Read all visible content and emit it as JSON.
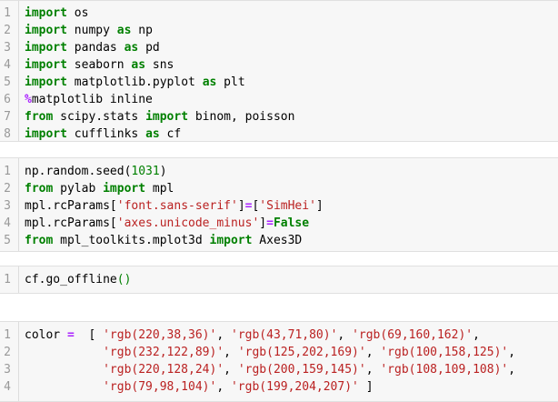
{
  "cells": [
    {
      "lines": [
        {
          "n": "1",
          "tokens": [
            {
              "t": "kw",
              "v": "import"
            },
            {
              "t": "",
              "v": " os"
            }
          ]
        },
        {
          "n": "2",
          "tokens": [
            {
              "t": "kw",
              "v": "import"
            },
            {
              "t": "",
              "v": " numpy "
            },
            {
              "t": "kw",
              "v": "as"
            },
            {
              "t": "",
              "v": " np"
            }
          ]
        },
        {
          "n": "3",
          "tokens": [
            {
              "t": "kw",
              "v": "import"
            },
            {
              "t": "",
              "v": " pandas "
            },
            {
              "t": "kw",
              "v": "as"
            },
            {
              "t": "",
              "v": " pd"
            }
          ]
        },
        {
          "n": "4",
          "tokens": [
            {
              "t": "kw",
              "v": "import"
            },
            {
              "t": "",
              "v": " seaborn "
            },
            {
              "t": "kw",
              "v": "as"
            },
            {
              "t": "",
              "v": " sns"
            }
          ]
        },
        {
          "n": "5",
          "tokens": [
            {
              "t": "kw",
              "v": "import"
            },
            {
              "t": "",
              "v": " matplotlib.pyplot "
            },
            {
              "t": "kw",
              "v": "as"
            },
            {
              "t": "",
              "v": " plt"
            }
          ]
        },
        {
          "n": "6",
          "tokens": [
            {
              "t": "op",
              "v": "%"
            },
            {
              "t": "",
              "v": "matplotlib inline"
            }
          ]
        },
        {
          "n": "7",
          "tokens": [
            {
              "t": "kw",
              "v": "from"
            },
            {
              "t": "",
              "v": " scipy.stats "
            },
            {
              "t": "kw",
              "v": "import"
            },
            {
              "t": "",
              "v": " binom, poisson"
            }
          ]
        },
        {
          "n": "8",
          "tokens": [
            {
              "t": "kw",
              "v": "import"
            },
            {
              "t": "",
              "v": " cufflinks "
            },
            {
              "t": "kw",
              "v": "as"
            },
            {
              "t": "",
              "v": " cf"
            }
          ]
        }
      ]
    },
    {
      "lines": [
        {
          "n": "1",
          "tokens": [
            {
              "t": "",
              "v": "np.random.seed("
            },
            {
              "t": "num",
              "v": "1031"
            },
            {
              "t": "",
              "v": ")"
            }
          ]
        },
        {
          "n": "2",
          "tokens": [
            {
              "t": "kw",
              "v": "from"
            },
            {
              "t": "",
              "v": " pylab "
            },
            {
              "t": "kw",
              "v": "import"
            },
            {
              "t": "",
              "v": " mpl"
            }
          ]
        },
        {
          "n": "3",
          "tokens": [
            {
              "t": "",
              "v": "mpl.rcParams["
            },
            {
              "t": "str",
              "v": "'font.sans-serif'"
            },
            {
              "t": "",
              "v": "]"
            },
            {
              "t": "op",
              "v": "="
            },
            {
              "t": "",
              "v": "["
            },
            {
              "t": "str",
              "v": "'SimHei'"
            },
            {
              "t": "",
              "v": "]"
            }
          ]
        },
        {
          "n": "4",
          "tokens": [
            {
              "t": "",
              "v": "mpl.rcParams["
            },
            {
              "t": "str",
              "v": "'axes.unicode_minus'"
            },
            {
              "t": "",
              "v": "]"
            },
            {
              "t": "op",
              "v": "="
            },
            {
              "t": "kw",
              "v": "False"
            }
          ]
        },
        {
          "n": "5",
          "tokens": [
            {
              "t": "kw",
              "v": "from"
            },
            {
              "t": "",
              "v": " mpl_toolkits.mplot3d "
            },
            {
              "t": "kw",
              "v": "import"
            },
            {
              "t": "",
              "v": " Axes3D"
            }
          ]
        }
      ]
    },
    {
      "lines": [
        {
          "n": "1",
          "tokens": [
            {
              "t": "",
              "v": "cf.go_offline"
            },
            {
              "t": "paren-hl",
              "v": "()"
            }
          ]
        }
      ]
    },
    {
      "lines": [
        {
          "n": "1",
          "tokens": [
            {
              "t": "",
              "v": "color "
            },
            {
              "t": "op",
              "v": "="
            },
            {
              "t": "",
              "v": "  [ "
            },
            {
              "t": "str",
              "v": "'rgb(220,38,36)'"
            },
            {
              "t": "",
              "v": ", "
            },
            {
              "t": "str",
              "v": "'rgb(43,71,80)'"
            },
            {
              "t": "",
              "v": ", "
            },
            {
              "t": "str",
              "v": "'rgb(69,160,162)'"
            },
            {
              "t": "",
              "v": ","
            }
          ]
        },
        {
          "n": "2",
          "tokens": [
            {
              "t": "",
              "v": "           "
            },
            {
              "t": "str",
              "v": "'rgb(232,122,89)'"
            },
            {
              "t": "",
              "v": ", "
            },
            {
              "t": "str",
              "v": "'rgb(125,202,169)'"
            },
            {
              "t": "",
              "v": ", "
            },
            {
              "t": "str",
              "v": "'rgb(100,158,125)'"
            },
            {
              "t": "",
              "v": ","
            }
          ]
        },
        {
          "n": "3",
          "tokens": [
            {
              "t": "",
              "v": "           "
            },
            {
              "t": "str",
              "v": "'rgb(220,128,24)'"
            },
            {
              "t": "",
              "v": ", "
            },
            {
              "t": "str",
              "v": "'rgb(200,159,145)'"
            },
            {
              "t": "",
              "v": ", "
            },
            {
              "t": "str",
              "v": "'rgb(108,109,108)'"
            },
            {
              "t": "",
              "v": ","
            }
          ]
        },
        {
          "n": "4",
          "tokens": [
            {
              "t": "",
              "v": "           "
            },
            {
              "t": "str",
              "v": "'rgb(79,98,104)'"
            },
            {
              "t": "",
              "v": ", "
            },
            {
              "t": "str",
              "v": "'rgb(199,204,207)'"
            },
            {
              "t": "",
              "v": " ]"
            }
          ]
        }
      ]
    }
  ],
  "colors": {
    "keyword": "#008000",
    "string": "#ba2121",
    "operator": "#aa22ff",
    "number": "#008000",
    "line_number": "#999999",
    "cell_background": "#f7f7f7"
  }
}
